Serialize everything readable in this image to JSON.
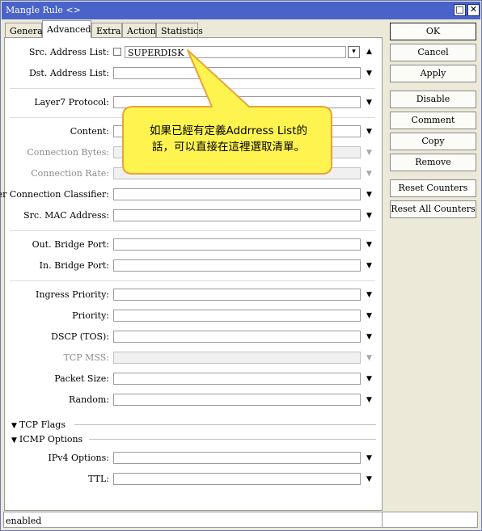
{
  "window": {
    "title": "Mangle Rule <>",
    "maximize_glyph": "□",
    "close_glyph": "✕"
  },
  "tabs": [
    {
      "label": "General"
    },
    {
      "label": "Advanced"
    },
    {
      "label": "Extra"
    },
    {
      "label": "Action"
    },
    {
      "label": "Statistics"
    }
  ],
  "fields": {
    "src_address_list": {
      "label": "Src. Address List:",
      "value": "SUPERDISK"
    },
    "dst_address_list": {
      "label": "Dst. Address List:"
    },
    "layer7_protocol": {
      "label": "Layer7 Protocol:"
    },
    "content": {
      "label": "Content:"
    },
    "connection_bytes": {
      "label": "Connection Bytes:"
    },
    "connection_rate": {
      "label": "Connection Rate:"
    },
    "per_connection_classifier": {
      "label": "Per Connection Classifier:"
    },
    "src_mac_address": {
      "label": "Src. MAC Address:"
    },
    "out_bridge_port": {
      "label": "Out. Bridge Port:"
    },
    "in_bridge_port": {
      "label": "In. Bridge Port:"
    },
    "ingress_priority": {
      "label": "Ingress Priority:"
    },
    "priority": {
      "label": "Priority:"
    },
    "dscp_tos": {
      "label": "DSCP (TOS):"
    },
    "tcp_mss": {
      "label": "TCP MSS:"
    },
    "packet_size": {
      "label": "Packet Size:"
    },
    "random": {
      "label": "Random:"
    },
    "ipv4_options": {
      "label": "IPv4 Options:"
    },
    "ttl": {
      "label": "TTL:"
    }
  },
  "sections": {
    "tcp_flags": "TCP Flags",
    "icmp_options": "ICMP Options"
  },
  "glyphs": {
    "arrow_down": "▼",
    "arrow_up": "▲",
    "section_tri": "▼",
    "dropdown": "▾"
  },
  "buttons": {
    "ok": "OK",
    "cancel": "Cancel",
    "apply": "Apply",
    "disable": "Disable",
    "comment": "Comment",
    "copy": "Copy",
    "remove": "Remove",
    "reset_counters": "Reset Counters",
    "reset_all_counters": "Reset All Counters"
  },
  "status": {
    "text": "enabled"
  },
  "callout": {
    "line1": "如果已經有定義Addrress List的",
    "line2": "話，可以直接在這裡選取清單。"
  },
  "colors": {
    "titlebar": "#4a63c9",
    "window_bg": "#ece9d8",
    "callout_fill": "#fff44f",
    "callout_border": "#e8a33a"
  }
}
